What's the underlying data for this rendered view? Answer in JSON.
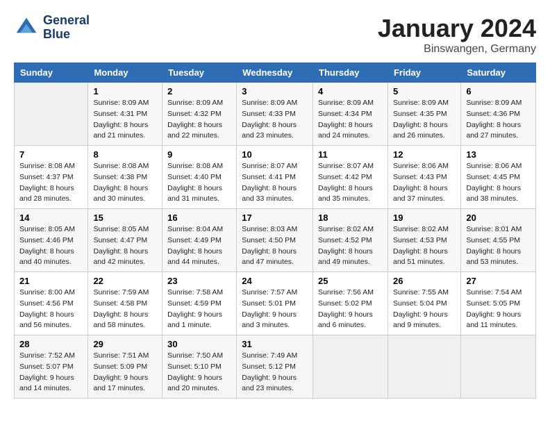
{
  "header": {
    "logo_line1": "General",
    "logo_line2": "Blue",
    "month": "January 2024",
    "location": "Binswangen, Germany"
  },
  "days_of_week": [
    "Sunday",
    "Monday",
    "Tuesday",
    "Wednesday",
    "Thursday",
    "Friday",
    "Saturday"
  ],
  "weeks": [
    [
      {
        "day": "",
        "empty": true
      },
      {
        "day": "1",
        "sunrise": "Sunrise: 8:09 AM",
        "sunset": "Sunset: 4:31 PM",
        "daylight": "Daylight: 8 hours and 21 minutes."
      },
      {
        "day": "2",
        "sunrise": "Sunrise: 8:09 AM",
        "sunset": "Sunset: 4:32 PM",
        "daylight": "Daylight: 8 hours and 22 minutes."
      },
      {
        "day": "3",
        "sunrise": "Sunrise: 8:09 AM",
        "sunset": "Sunset: 4:33 PM",
        "daylight": "Daylight: 8 hours and 23 minutes."
      },
      {
        "day": "4",
        "sunrise": "Sunrise: 8:09 AM",
        "sunset": "Sunset: 4:34 PM",
        "daylight": "Daylight: 8 hours and 24 minutes."
      },
      {
        "day": "5",
        "sunrise": "Sunrise: 8:09 AM",
        "sunset": "Sunset: 4:35 PM",
        "daylight": "Daylight: 8 hours and 26 minutes."
      },
      {
        "day": "6",
        "sunrise": "Sunrise: 8:09 AM",
        "sunset": "Sunset: 4:36 PM",
        "daylight": "Daylight: 8 hours and 27 minutes."
      }
    ],
    [
      {
        "day": "7",
        "sunrise": "Sunrise: 8:08 AM",
        "sunset": "Sunset: 4:37 PM",
        "daylight": "Daylight: 8 hours and 28 minutes."
      },
      {
        "day": "8",
        "sunrise": "Sunrise: 8:08 AM",
        "sunset": "Sunset: 4:38 PM",
        "daylight": "Daylight: 8 hours and 30 minutes."
      },
      {
        "day": "9",
        "sunrise": "Sunrise: 8:08 AM",
        "sunset": "Sunset: 4:40 PM",
        "daylight": "Daylight: 8 hours and 31 minutes."
      },
      {
        "day": "10",
        "sunrise": "Sunrise: 8:07 AM",
        "sunset": "Sunset: 4:41 PM",
        "daylight": "Daylight: 8 hours and 33 minutes."
      },
      {
        "day": "11",
        "sunrise": "Sunrise: 8:07 AM",
        "sunset": "Sunset: 4:42 PM",
        "daylight": "Daylight: 8 hours and 35 minutes."
      },
      {
        "day": "12",
        "sunrise": "Sunrise: 8:06 AM",
        "sunset": "Sunset: 4:43 PM",
        "daylight": "Daylight: 8 hours and 37 minutes."
      },
      {
        "day": "13",
        "sunrise": "Sunrise: 8:06 AM",
        "sunset": "Sunset: 4:45 PM",
        "daylight": "Daylight: 8 hours and 38 minutes."
      }
    ],
    [
      {
        "day": "14",
        "sunrise": "Sunrise: 8:05 AM",
        "sunset": "Sunset: 4:46 PM",
        "daylight": "Daylight: 8 hours and 40 minutes."
      },
      {
        "day": "15",
        "sunrise": "Sunrise: 8:05 AM",
        "sunset": "Sunset: 4:47 PM",
        "daylight": "Daylight: 8 hours and 42 minutes."
      },
      {
        "day": "16",
        "sunrise": "Sunrise: 8:04 AM",
        "sunset": "Sunset: 4:49 PM",
        "daylight": "Daylight: 8 hours and 44 minutes."
      },
      {
        "day": "17",
        "sunrise": "Sunrise: 8:03 AM",
        "sunset": "Sunset: 4:50 PM",
        "daylight": "Daylight: 8 hours and 47 minutes."
      },
      {
        "day": "18",
        "sunrise": "Sunrise: 8:02 AM",
        "sunset": "Sunset: 4:52 PM",
        "daylight": "Daylight: 8 hours and 49 minutes."
      },
      {
        "day": "19",
        "sunrise": "Sunrise: 8:02 AM",
        "sunset": "Sunset: 4:53 PM",
        "daylight": "Daylight: 8 hours and 51 minutes."
      },
      {
        "day": "20",
        "sunrise": "Sunrise: 8:01 AM",
        "sunset": "Sunset: 4:55 PM",
        "daylight": "Daylight: 8 hours and 53 minutes."
      }
    ],
    [
      {
        "day": "21",
        "sunrise": "Sunrise: 8:00 AM",
        "sunset": "Sunset: 4:56 PM",
        "daylight": "Daylight: 8 hours and 56 minutes."
      },
      {
        "day": "22",
        "sunrise": "Sunrise: 7:59 AM",
        "sunset": "Sunset: 4:58 PM",
        "daylight": "Daylight: 8 hours and 58 minutes."
      },
      {
        "day": "23",
        "sunrise": "Sunrise: 7:58 AM",
        "sunset": "Sunset: 4:59 PM",
        "daylight": "Daylight: 9 hours and 1 minute."
      },
      {
        "day": "24",
        "sunrise": "Sunrise: 7:57 AM",
        "sunset": "Sunset: 5:01 PM",
        "daylight": "Daylight: 9 hours and 3 minutes."
      },
      {
        "day": "25",
        "sunrise": "Sunrise: 7:56 AM",
        "sunset": "Sunset: 5:02 PM",
        "daylight": "Daylight: 9 hours and 6 minutes."
      },
      {
        "day": "26",
        "sunrise": "Sunrise: 7:55 AM",
        "sunset": "Sunset: 5:04 PM",
        "daylight": "Daylight: 9 hours and 9 minutes."
      },
      {
        "day": "27",
        "sunrise": "Sunrise: 7:54 AM",
        "sunset": "Sunset: 5:05 PM",
        "daylight": "Daylight: 9 hours and 11 minutes."
      }
    ],
    [
      {
        "day": "28",
        "sunrise": "Sunrise: 7:52 AM",
        "sunset": "Sunset: 5:07 PM",
        "daylight": "Daylight: 9 hours and 14 minutes."
      },
      {
        "day": "29",
        "sunrise": "Sunrise: 7:51 AM",
        "sunset": "Sunset: 5:09 PM",
        "daylight": "Daylight: 9 hours and 17 minutes."
      },
      {
        "day": "30",
        "sunrise": "Sunrise: 7:50 AM",
        "sunset": "Sunset: 5:10 PM",
        "daylight": "Daylight: 9 hours and 20 minutes."
      },
      {
        "day": "31",
        "sunrise": "Sunrise: 7:49 AM",
        "sunset": "Sunset: 5:12 PM",
        "daylight": "Daylight: 9 hours and 23 minutes."
      },
      {
        "day": "",
        "empty": true
      },
      {
        "day": "",
        "empty": true
      },
      {
        "day": "",
        "empty": true
      }
    ]
  ]
}
